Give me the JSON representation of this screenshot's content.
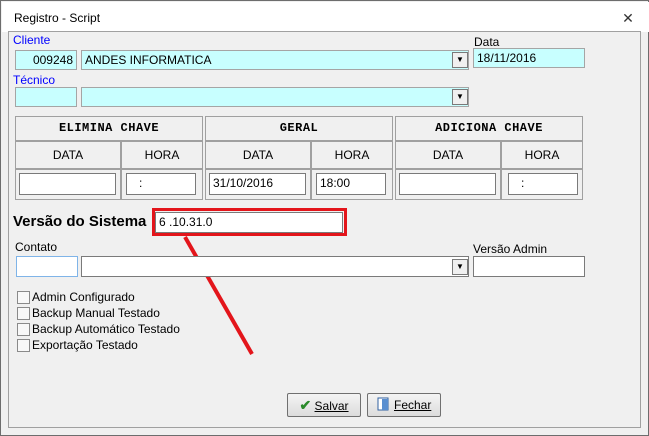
{
  "window": {
    "title": "Registro - Script",
    "close_glyph": "✕"
  },
  "cliente": {
    "label": "Cliente",
    "code": "009248",
    "name": "ANDES INFORMATICA"
  },
  "data": {
    "label": "Data",
    "value": "18/11/2016"
  },
  "tecnico": {
    "label": "Técnico",
    "value": ""
  },
  "sections": [
    {
      "title": "ELIMINA CHAVE",
      "col_data": "DATA",
      "col_hora": "HORA",
      "data_value": "",
      "hora_value": ":"
    },
    {
      "title": "GERAL",
      "col_data": "DATA",
      "col_hora": "HORA",
      "data_value": "31/10/2016",
      "hora_value": "18:00"
    },
    {
      "title": "ADICIONA CHAVE",
      "col_data": "DATA",
      "col_hora": "HORA",
      "data_value": "",
      "hora_value": ":"
    }
  ],
  "versao": {
    "label": "Versão do Sistema :",
    "value": "6 .10.31.0"
  },
  "contato": {
    "label": "Contato",
    "value": ""
  },
  "versao_admin": {
    "label": "Versão Admin",
    "value": ""
  },
  "checkboxes": [
    {
      "label": "Admin Configurado",
      "checked": false
    },
    {
      "label": "Backup Manual Testado",
      "checked": false
    },
    {
      "label": "Backup Automático Testado",
      "checked": false
    },
    {
      "label": "Exportação Testado",
      "checked": false
    }
  ],
  "buttons": {
    "salvar": "Salvar",
    "fechar": "Fechar"
  },
  "icons": {
    "dropdown": "chevron-down-icon",
    "check": "checkmark-icon",
    "door": "door-icon"
  },
  "colors": {
    "highlight": "#e3151b",
    "field_cyan": "#c8ffff",
    "label_blue": "#0000ff"
  }
}
